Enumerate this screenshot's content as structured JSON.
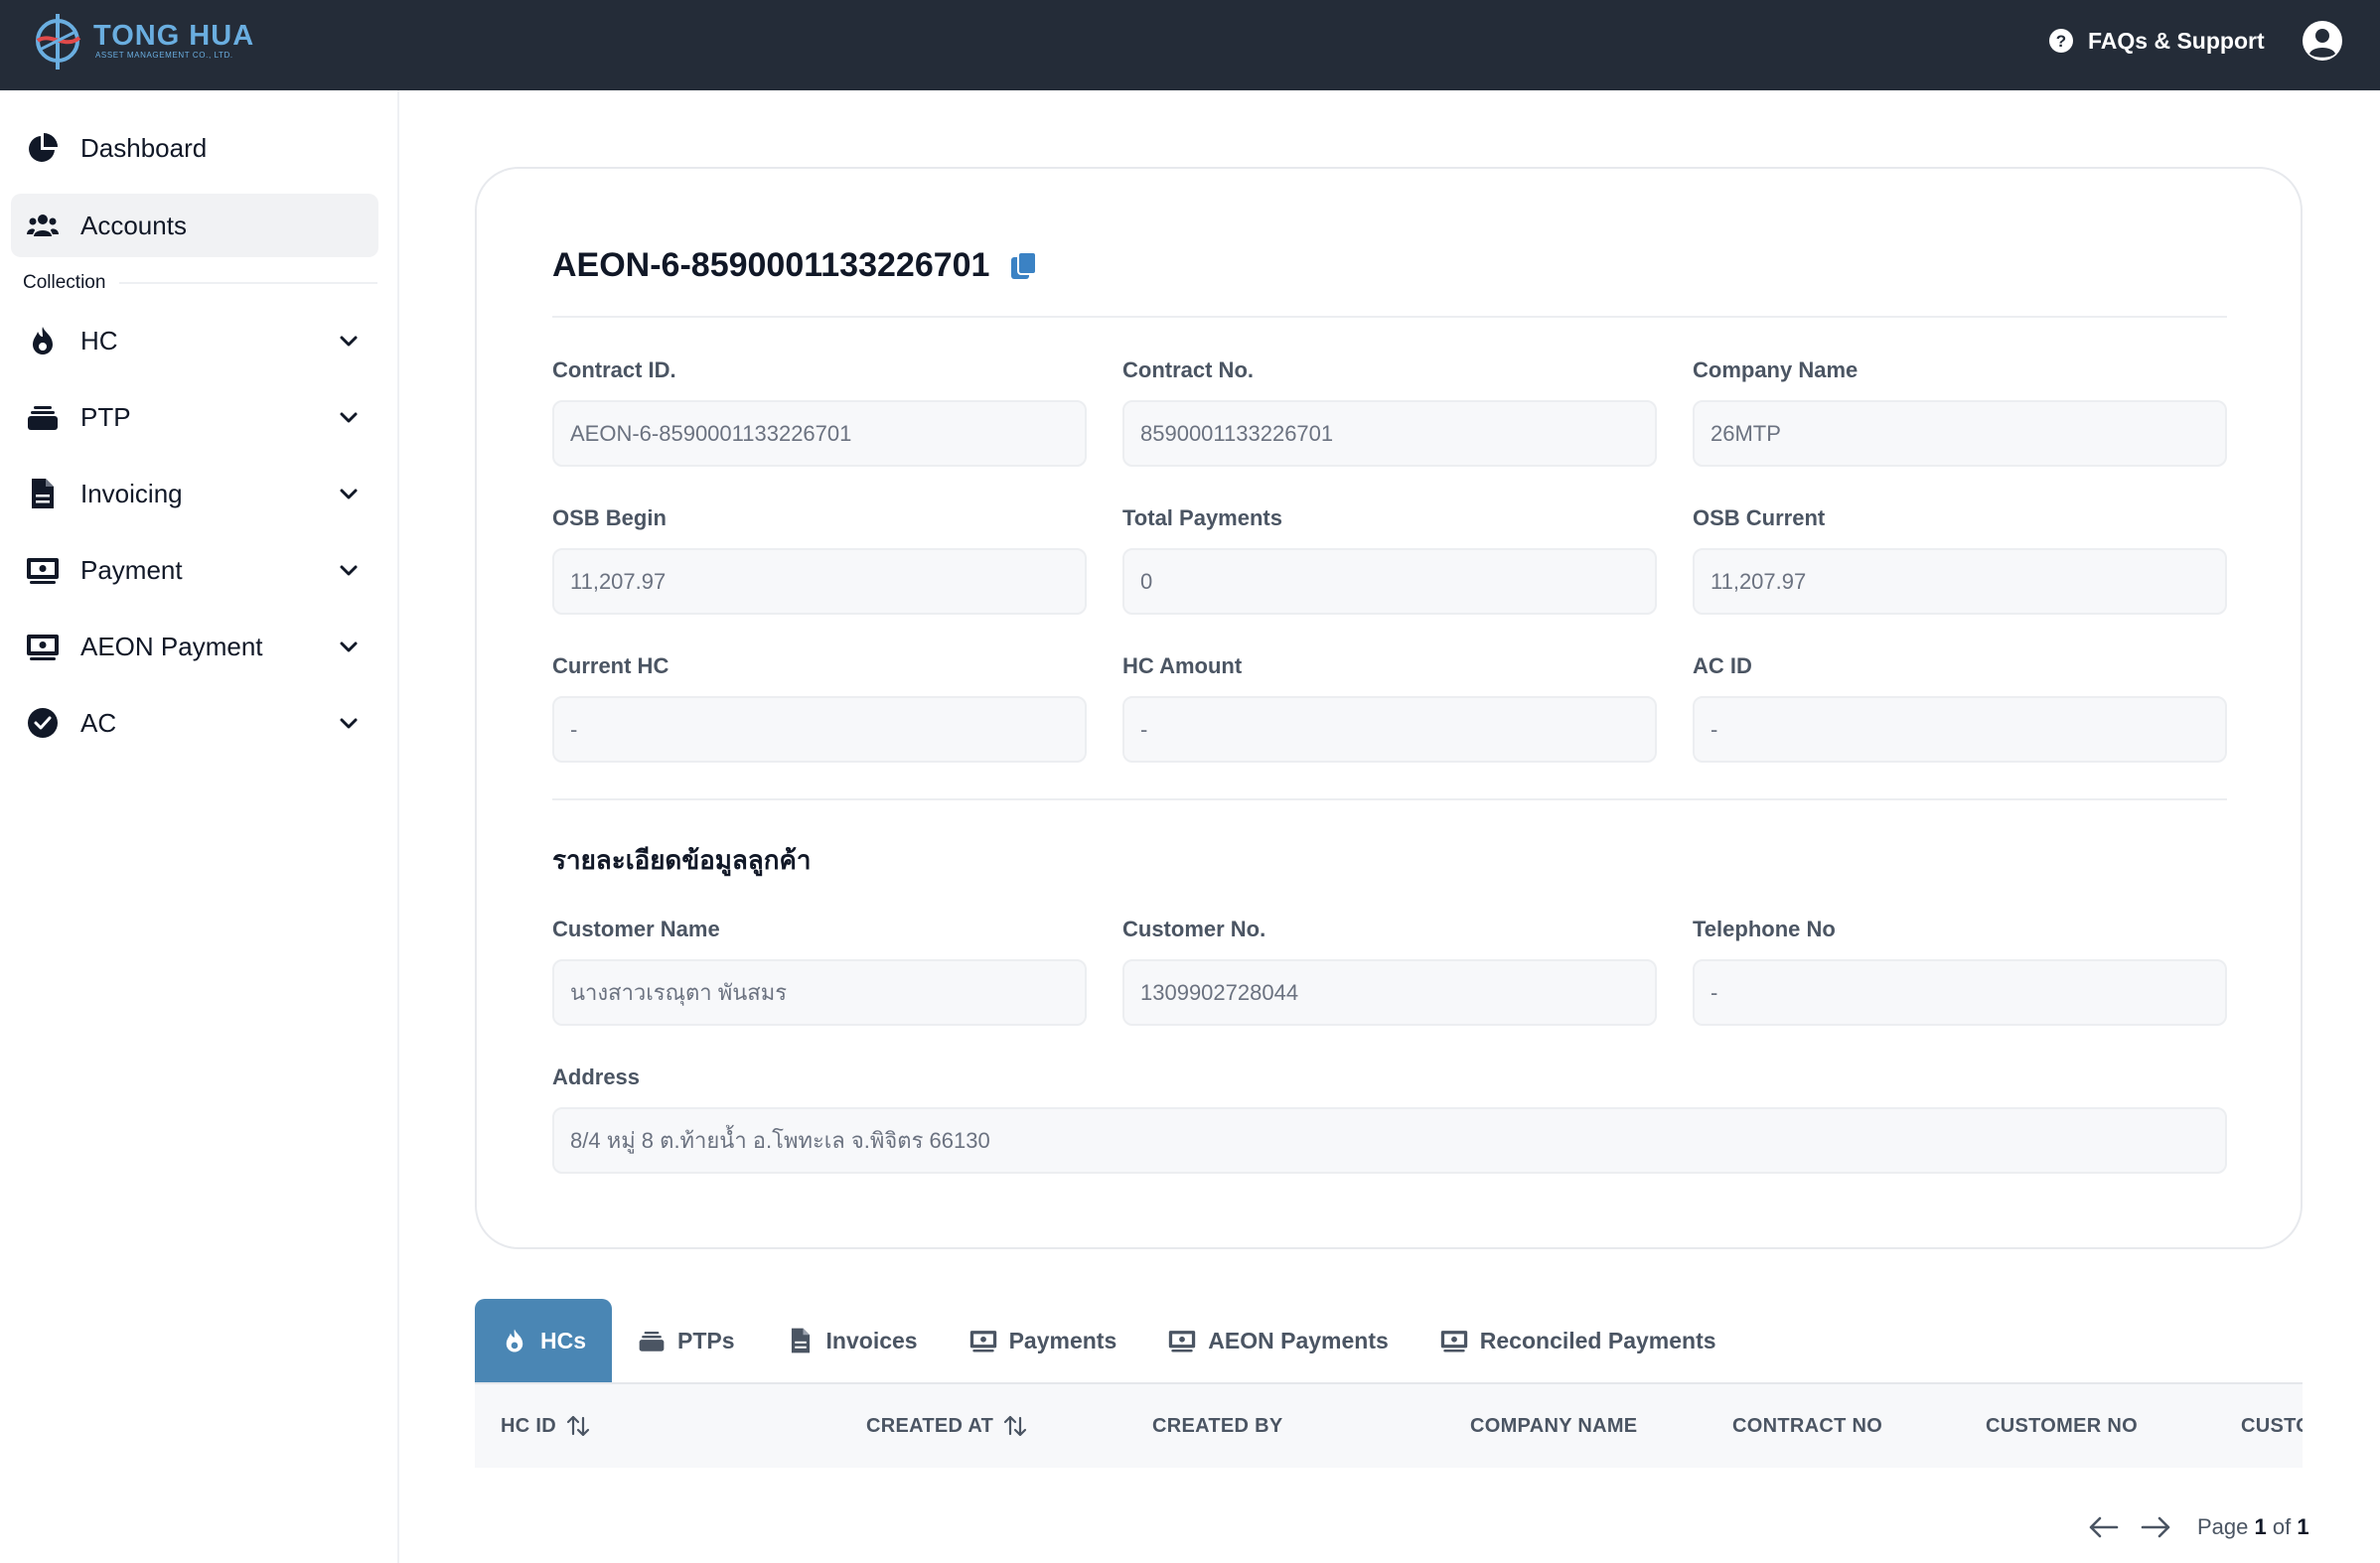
{
  "header": {
    "logo_name": "TONG HUA",
    "logo_sub": "ASSET MANAGEMENT CO., LTD.",
    "faq_label": "FAQs & Support"
  },
  "sidebar": {
    "items": [
      {
        "label": "Dashboard",
        "icon": "pie-chart-icon"
      },
      {
        "label": "Accounts",
        "icon": "users-icon"
      }
    ],
    "section_label": "Collection",
    "collection_items": [
      {
        "label": "HC",
        "icon": "fire-icon"
      },
      {
        "label": "PTP",
        "icon": "stack-icon"
      },
      {
        "label": "Invoicing",
        "icon": "document-icon"
      },
      {
        "label": "Payment",
        "icon": "cash-icon"
      },
      {
        "label": "AEON Payment",
        "icon": "cash-icon"
      },
      {
        "label": "AC",
        "icon": "check-circle-icon"
      }
    ]
  },
  "account": {
    "title": "AEON-6-8590001133226701",
    "fields": [
      {
        "label": "Contract ID.",
        "value": "AEON-6-8590001133226701"
      },
      {
        "label": "Contract No.",
        "value": "8590001133226701"
      },
      {
        "label": "Company Name",
        "value": "26MTP"
      },
      {
        "label": "OSB Begin",
        "value": "11,207.97"
      },
      {
        "label": "Total Payments",
        "value": "0"
      },
      {
        "label": "OSB Current",
        "value": "11,207.97"
      },
      {
        "label": "Current HC",
        "value": "-"
      },
      {
        "label": "HC Amount",
        "value": "-"
      },
      {
        "label": "AC ID",
        "value": "-"
      }
    ],
    "customer_section_title": "รายละเอียดข้อมูลลูกค้า",
    "customer_fields": [
      {
        "label": "Customer Name",
        "value": "นางสาวเรณุตา พันสมร"
      },
      {
        "label": "Customer No.",
        "value": "1309902728044"
      },
      {
        "label": "Telephone No",
        "value": "-"
      }
    ],
    "address": {
      "label": "Address",
      "value": "8/4 หมู่ 8 ต.ท้ายน้ำ อ.โพทะเล จ.พิจิตร 66130"
    }
  },
  "tabs": [
    {
      "label": "HCs",
      "icon": "fire-icon",
      "active": true
    },
    {
      "label": "PTPs",
      "icon": "stack-icon"
    },
    {
      "label": "Invoices",
      "icon": "document-icon"
    },
    {
      "label": "Payments",
      "icon": "cash-icon"
    },
    {
      "label": "AEON Payments",
      "icon": "cash-icon"
    },
    {
      "label": "Reconciled Payments",
      "icon": "cash-icon"
    }
  ],
  "table": {
    "columns": [
      "HC ID",
      "CREATED AT",
      "CREATED BY",
      "COMPANY NAME",
      "CONTRACT NO",
      "CUSTOMER NO",
      "CUSTO"
    ]
  },
  "pagination": {
    "prefix": "Page",
    "current": "1",
    "of": "of",
    "total": "1"
  },
  "colors": {
    "topbar": "#242c38",
    "accent": "#4a86b4",
    "copy_icon": "#3b82c4"
  }
}
